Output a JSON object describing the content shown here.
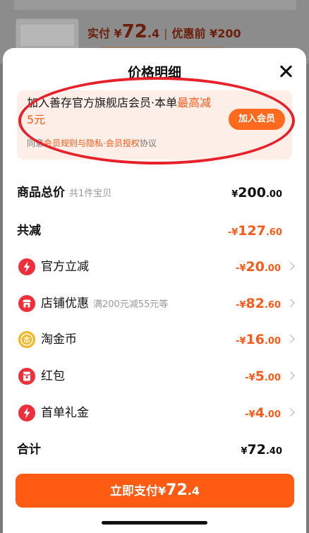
{
  "background": {
    "price_label": "实付 ¥",
    "price_int": "72",
    "price_dec": ".4",
    "divider": "|",
    "orig_label": "优惠前 ¥200"
  },
  "sheet": {
    "title": "价格明细"
  },
  "banner": {
    "text_normal": "加入善存官方旗舰店会员·本单",
    "text_highlight": "最高减5元",
    "sub_prefix": "同意",
    "sub_link": "会员规则与隐私·会员授权",
    "sub_suffix": "协议",
    "join_label": "加入会员"
  },
  "rows": {
    "total": {
      "label": "商品总价",
      "note": "共1件宝贝",
      "prefix": "¥",
      "int": "200",
      "dec": ".00"
    },
    "discount_sum": {
      "label": "共减",
      "prefix": "-¥",
      "int": "127",
      "dec": ".60"
    },
    "official": {
      "label": "官方立减",
      "prefix": "-¥",
      "int": "20",
      "dec": ".00"
    },
    "store": {
      "label": "店铺优惠",
      "note": "满200元减55元等",
      "prefix": "-¥",
      "int": "82",
      "dec": ".60"
    },
    "coins": {
      "label": "淘金币",
      "prefix": "-¥",
      "int": "16",
      "dec": ".00"
    },
    "redpacket": {
      "label": "红包",
      "prefix": "-¥",
      "int": "5",
      "dec": ".00"
    },
    "firstorder": {
      "label": "首单礼金",
      "prefix": "-¥",
      "int": "4",
      "dec": ".00"
    },
    "grand": {
      "label": "合计",
      "prefix": "¥",
      "int": "72",
      "dec": ".40"
    }
  },
  "pay": {
    "label": "立即支付",
    "prefix": "¥",
    "int": "72",
    "dec": ".4"
  },
  "icons": {
    "official": "lightning-icon",
    "store": "shop-icon",
    "coins": "coin-icon",
    "redpacket": "red-envelope-icon",
    "firstorder": "lightning-icon",
    "close": "close-icon"
  },
  "colors": {
    "accent": "#ff5a1a",
    "pay_button": "#ff5b13",
    "icon_red": "#ef2f3c",
    "icon_yellow": "#f7b423",
    "annotation_oval": "#e8202a"
  }
}
